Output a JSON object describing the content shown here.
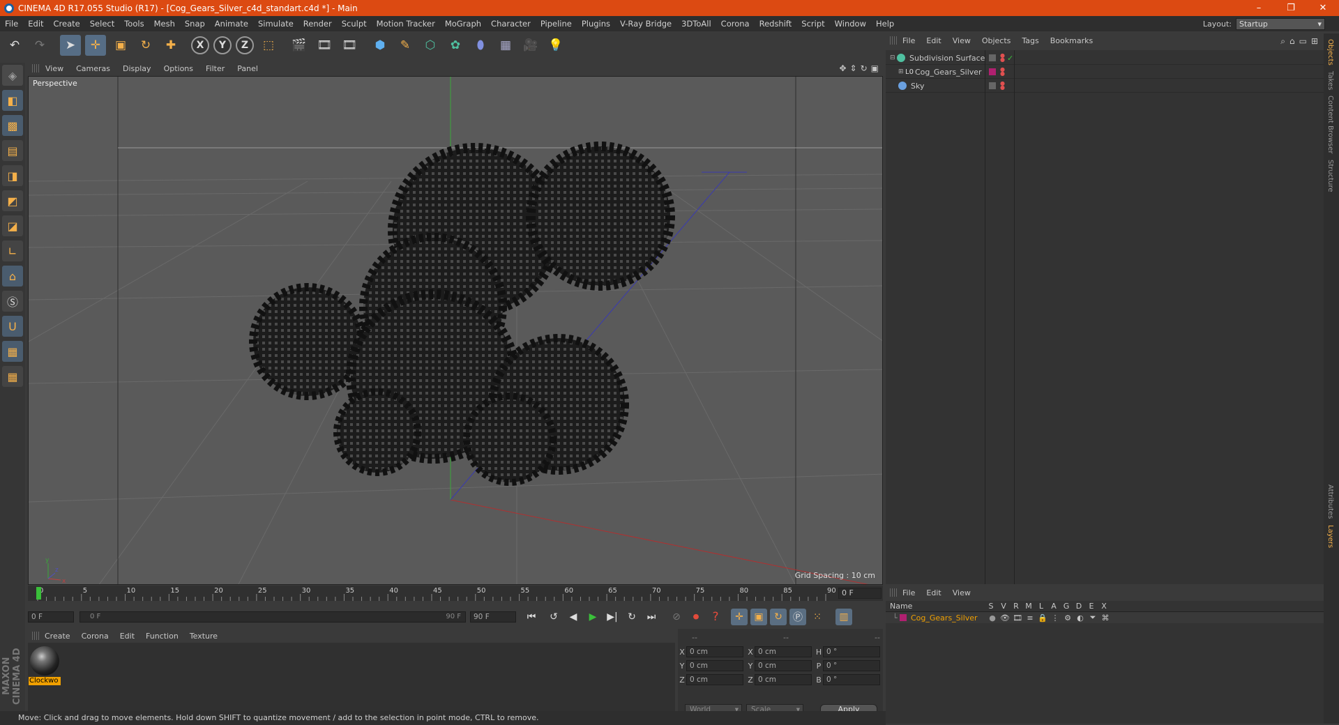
{
  "window": {
    "title": "CINEMA 4D R17.055 Studio (R17) - [Cog_Gears_Silver_c4d_standart.c4d *] - Main",
    "minimize": "–",
    "maximize": "❐",
    "close": "✕"
  },
  "menubar": {
    "items": [
      "File",
      "Edit",
      "Create",
      "Select",
      "Tools",
      "Mesh",
      "Snap",
      "Animate",
      "Simulate",
      "Render",
      "Sculpt",
      "Motion Tracker",
      "MoGraph",
      "Character",
      "Pipeline",
      "Plugins",
      "V-Ray Bridge",
      "3DToAll",
      "Corona",
      "Redshift",
      "Script",
      "Window",
      "Help"
    ],
    "layout_label": "Layout:",
    "layout_value": "Startup"
  },
  "viewport": {
    "menu": [
      "View",
      "Cameras",
      "Display",
      "Options",
      "Filter",
      "Panel"
    ],
    "label": "Perspective",
    "grid_spacing": "Grid Spacing : 10 cm"
  },
  "timeline": {
    "ticks": [
      "0",
      "5",
      "10",
      "15",
      "20",
      "25",
      "30",
      "35",
      "40",
      "45",
      "50",
      "55",
      "60",
      "65",
      "70",
      "75",
      "80",
      "85",
      "90"
    ],
    "current_frame": "0 F",
    "start_frame": "0 F",
    "range_start": "0 F",
    "range_end": "90 F",
    "end_frame": "90 F"
  },
  "material_manager": {
    "menu": [
      "Create",
      "Corona",
      "Edit",
      "Function",
      "Texture"
    ],
    "material_name": "Clockwo"
  },
  "coordinates": {
    "headers": [
      "--",
      "--",
      "--"
    ],
    "rows": [
      {
        "a1": "X",
        "v1": "0 cm",
        "a2": "X",
        "v2": "0 cm",
        "a3": "H",
        "v3": "0 °"
      },
      {
        "a1": "Y",
        "v1": "0 cm",
        "a2": "Y",
        "v2": "0 cm",
        "a3": "P",
        "v3": "0 °"
      },
      {
        "a1": "Z",
        "v1": "0 cm",
        "a2": "Z",
        "v2": "0 cm",
        "a3": "B",
        "v3": "0 °"
      }
    ],
    "mode1": "World",
    "mode2": "Scale",
    "apply": "Apply"
  },
  "status": "Move: Click and drag to move elements. Hold down SHIFT to quantize movement / add to the selection in point mode, CTRL to remove.",
  "object_manager": {
    "menu": [
      "File",
      "Edit",
      "View",
      "Objects",
      "Tags",
      "Bookmarks"
    ],
    "objects": [
      {
        "name": "Subdivision Surface",
        "color": "#4fc0a0"
      },
      {
        "name": "Cog_Gears_Silver",
        "color": "#c8a040"
      },
      {
        "name": "Sky",
        "color": "#6aa0e0"
      }
    ]
  },
  "right_tabs": [
    "Objects",
    "Takes",
    "Content Browser",
    "Structure",
    "Attributes",
    "Layers"
  ],
  "layer_manager": {
    "menu": [
      "File",
      "Edit",
      "View"
    ],
    "columns": [
      "Name",
      "S",
      "V",
      "R",
      "M",
      "L",
      "A",
      "G",
      "D",
      "E",
      "X"
    ],
    "layer_name": "Cog_Gears_Silver"
  }
}
